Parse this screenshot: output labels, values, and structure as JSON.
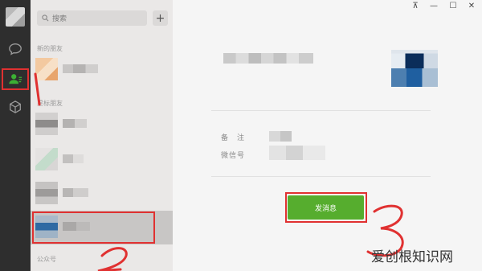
{
  "sidebar": {
    "icons": [
      "profile-avatar",
      "chat-icon",
      "contacts-icon",
      "box-icon"
    ]
  },
  "contacts": {
    "search": {
      "placeholder": "搜索"
    },
    "add_label": "+",
    "sections": {
      "new_friends": "新的朋友",
      "starred": "星标朋友",
      "official": "公众号"
    }
  },
  "window": {
    "pin": "⊼",
    "minimize": "—",
    "maximize": "☐",
    "close": "✕"
  },
  "profile": {
    "remark_label": "备　注",
    "wechat_id_label": "微信号",
    "send_message_label": "发消息"
  },
  "annotations": {
    "n1": "1",
    "n2": "2",
    "n3": "3"
  },
  "watermark": "爱创根知识网",
  "colors": {
    "send_button": "#56ad2e",
    "annotation_red": "#e03131",
    "rail": "#2e2e2e"
  }
}
